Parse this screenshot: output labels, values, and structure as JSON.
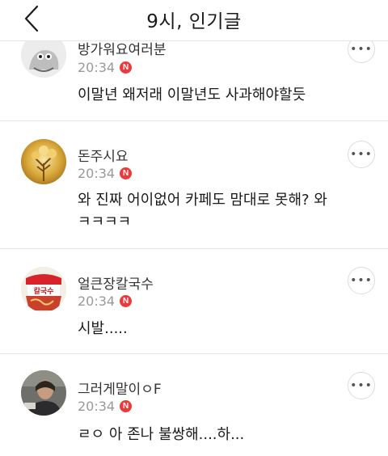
{
  "header": {
    "title": "9시, 인기글",
    "back_icon": "chevron-left-icon"
  },
  "comments": [
    {
      "nickname": "방가워요여러분",
      "time": "20:34",
      "new_badge": "N",
      "text": "이말년 왜저래 이말년도 사과해야할듯"
    },
    {
      "nickname": "돈주시요",
      "time": "20:34",
      "new_badge": "N",
      "text": "와 진짜 어이없어 카페도 맘대로 못해? 와 ㅋㅋㅋㅋ"
    },
    {
      "nickname": "얼큰장칼국수",
      "time": "20:34",
      "new_badge": "N",
      "text": "시발....."
    },
    {
      "nickname": "그러게말이ㅇF",
      "time": "20:34",
      "new_badge": "N",
      "text": "ㄹㅇ 아 존나 불쌍해....하..."
    }
  ],
  "more_button_icon": "more-horizontal-icon",
  "colors": {
    "new_badge": "#ea3a3a",
    "divider": "#e4e4e4",
    "meta_text": "#999999"
  }
}
